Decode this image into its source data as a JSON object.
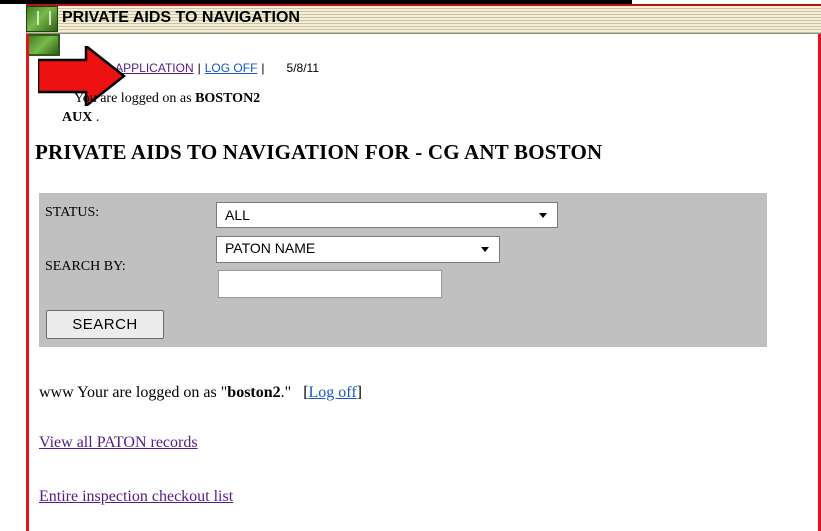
{
  "header": {
    "title": "PRIVATE AIDS TO NAVIGATION",
    "logo_icon": "green-emblem-icon"
  },
  "nav": {
    "home_label": "E",
    "application_label": "APPLICATION",
    "logoff_label": "LOG OFF",
    "separator": "|",
    "date": "5/8/11"
  },
  "session": {
    "logged_prefix": "You are logged on as",
    "user": "BOSTON2",
    "group": "AUX",
    "group_suffix": "."
  },
  "page_title": "PRIVATE AIDS TO NAVIGATION FOR - CG ANT BOSTON",
  "search_form": {
    "status_label": "STATUS:",
    "status_value": "ALL",
    "search_by_label": "SEARCH BY:",
    "search_by_value": "PATON NAME",
    "search_text_value": "",
    "search_button_label": "SEARCH"
  },
  "footer": {
    "prefix": "www Your are logged on as \"",
    "user": "boston2",
    "suffix": ".\"",
    "logoff_open": "[",
    "logoff_label": "Log off",
    "logoff_close": "]",
    "view_all_label": "View all PATON records",
    "inspection_label": "Entire inspection checkout list"
  },
  "colors": {
    "frame_red": "#e0141c",
    "panel_gray": "#c0c0c0",
    "visited_link": "#551a8b",
    "link_blue": "#1a56c9",
    "arrow_red": "#ee1111"
  }
}
